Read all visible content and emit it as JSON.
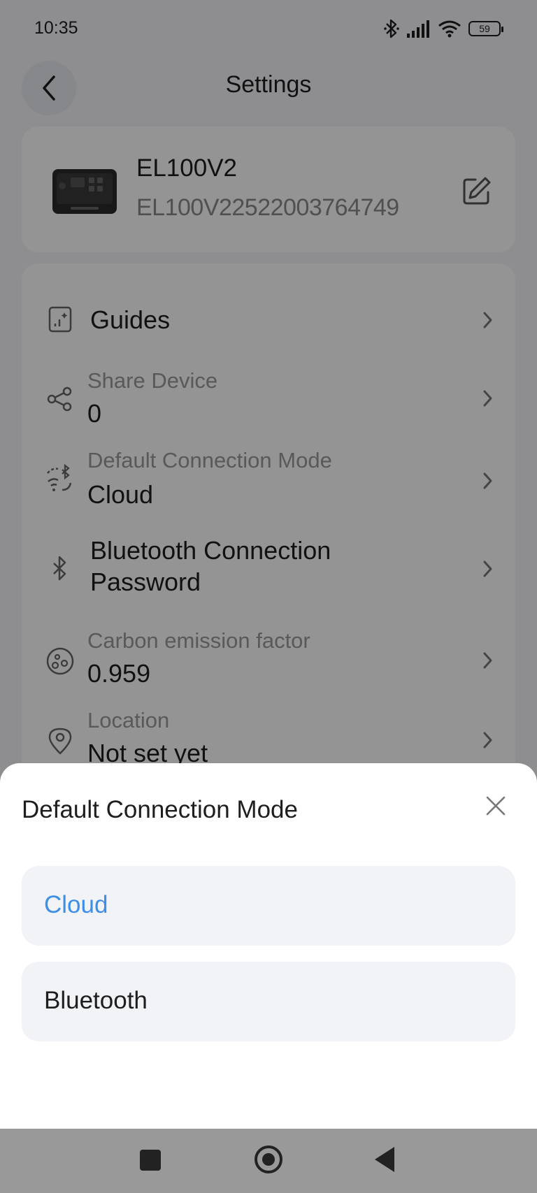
{
  "status_bar": {
    "time": "10:35",
    "battery": "59",
    "icons": [
      "bluetooth-icon",
      "cellular-signal-icon",
      "wifi-icon",
      "battery-icon"
    ]
  },
  "header": {
    "title": "Settings",
    "back_icon": "chevron-left-icon"
  },
  "device": {
    "name": "EL100V2",
    "serial": "EL100V22522003764749",
    "edit_icon": "edit-icon"
  },
  "settings": {
    "guides": {
      "label": "Guides",
      "icon": "guide-book-icon"
    },
    "share_device": {
      "label": "Share Device",
      "value": "0",
      "icon": "share-icon"
    },
    "default_connection": {
      "label": "Default Connection Mode",
      "value": "Cloud",
      "icon": "wifi-bluetooth-icon"
    },
    "bluetooth_password": {
      "label_line1": "Bluetooth Connection",
      "label_line2": "Password",
      "icon": "bluetooth-icon"
    },
    "carbon": {
      "label": "Carbon emission factor",
      "value": "0.959",
      "icon": "carbon-icon"
    },
    "location": {
      "label": "Location",
      "value": "Not set yet",
      "icon": "location-pin-icon"
    }
  },
  "sheet": {
    "title": "Default Connection Mode",
    "options": [
      {
        "label": "Cloud",
        "selected": true
      },
      {
        "label": "Bluetooth",
        "selected": false
      }
    ]
  },
  "colors": {
    "accent": "#3d8ee6",
    "overlay": "#000000"
  }
}
